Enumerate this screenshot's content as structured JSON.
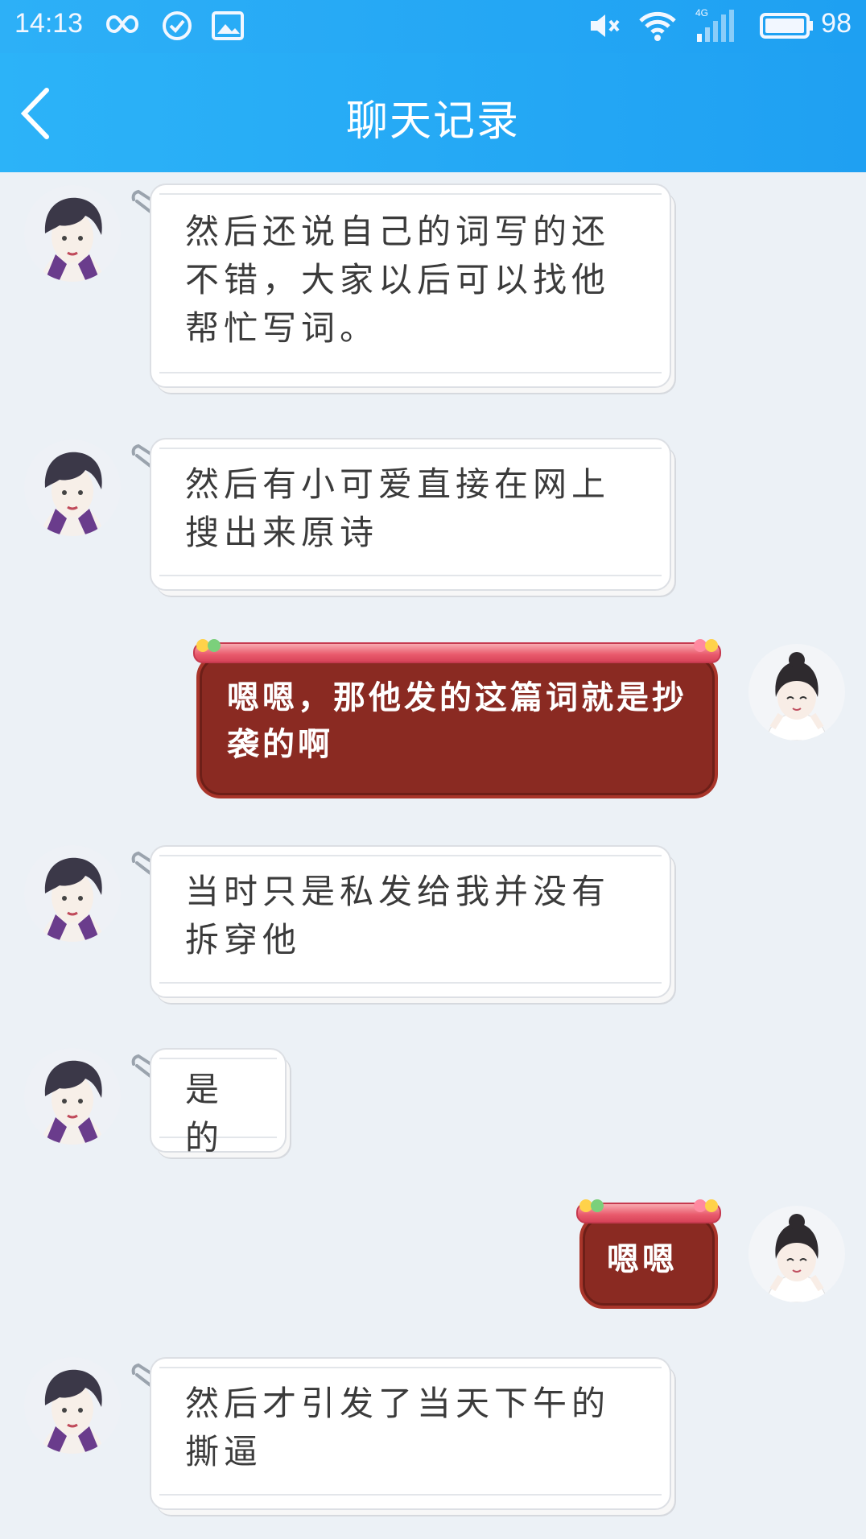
{
  "status_bar": {
    "time": "14:13",
    "network": "4G",
    "battery": "98"
  },
  "header": {
    "title": "聊天记录"
  },
  "messages": [
    {
      "side": "left",
      "text": "然后还说自己的词写的还不错，大家以后可以找他帮忙写词。"
    },
    {
      "side": "left",
      "text": "然后有小可爱直接在网上搜出来原诗"
    },
    {
      "side": "right",
      "text": "嗯嗯，那他发的这篇词就是抄袭的啊"
    },
    {
      "side": "left",
      "text": "当时只是私发给我并没有拆穿他"
    },
    {
      "side": "left",
      "text": "是的"
    },
    {
      "side": "right",
      "text": "嗯嗯"
    },
    {
      "side": "left",
      "text": "然后才引发了当天下午的撕逼"
    }
  ],
  "colors": {
    "header_blue": "#1fa0f2",
    "chat_bg": "#ecf1f6",
    "red_bubble": "#8a2a22"
  }
}
